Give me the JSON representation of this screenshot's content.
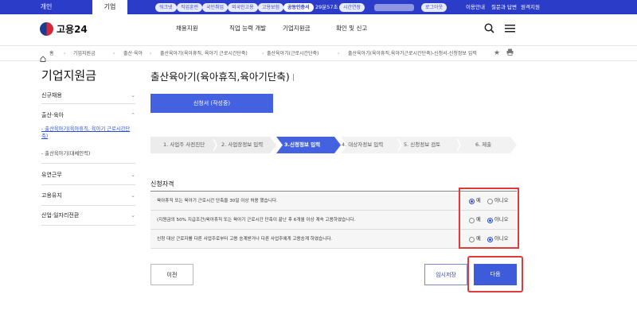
{
  "topbar": {
    "tabs": [
      "개인",
      "기업"
    ],
    "pills": [
      "워크넷",
      "직업훈련",
      "국민취업",
      "외국인고용",
      "고용보험",
      "공동인증서"
    ],
    "timer": "29분57초",
    "extend": "시간연장",
    "logout": "로그아웃",
    "links": [
      "이용안내",
      "질문과 답변",
      "원격지원"
    ]
  },
  "header": {
    "logo_text": "고용24",
    "nav": [
      "채용지원",
      "직업 능력 개발",
      "기업지원금",
      "확인 및 신고"
    ],
    "search_icon": "search-icon",
    "menu_icon": "menu-icon"
  },
  "breadcrumb": {
    "home": "홈",
    "items": [
      "기업지원금",
      "출산·육아",
      "출산육아기(육아휴직, 육아기 근로시간단축)",
      "출산육아기(근로시간단축)",
      "출산육아기(육아휴직,육아기근로시간단축)-신청서-신청정보 입력"
    ]
  },
  "sidebar": {
    "title": "기업지원금",
    "sections": [
      {
        "label": "신규채용"
      },
      {
        "label": "출산·육아"
      },
      {
        "label": "유연근무"
      },
      {
        "label": "고용유지"
      },
      {
        "label": "산업·일자리전환"
      }
    ],
    "subitems": [
      "- 출산육아기(육아휴직, 육아기 근로시간단축)",
      "- 출산육아기(대체인력)"
    ]
  },
  "main": {
    "title": "출산육아기(육아휴직,육아기단축)",
    "app_button": "신청서 (작성중)",
    "steps": [
      "1. 사업주 사전진단",
      "2. 사업장정보 입력",
      "3.신청정보 입력",
      "4. 대상자정보 입력",
      "5. 신청정보 검토",
      "6. 제출"
    ],
    "section_title": "신청자격",
    "questions": [
      {
        "text": "육아휴직 또는 육아기 근로시간 단축을 30일 이상 허용 했습니다.",
        "yes": "예",
        "no": "아니오",
        "selected": "yes"
      },
      {
        "text": "(지원금의 50% 지급조건)육아휴직 또는 육아기 근로시간 단축이 끝난 후 6개월 이상 계속 고용하였습니다.",
        "yes": "예",
        "no": "아니오",
        "selected": "no"
      },
      {
        "text": "신청 대상 근로자를 다른 사업주로부터 고용 승계받거나 다른 사업주에게 고용승계 하였습니다.",
        "yes": "예",
        "no": "아니오",
        "selected": "no"
      }
    ],
    "buttons": {
      "prev": "이전",
      "temp_save": "임시저장",
      "next": "다음"
    }
  },
  "colors": {
    "brand": "#2b3cc9",
    "primary": "#4461e0",
    "highlight": "#e03a3a"
  }
}
